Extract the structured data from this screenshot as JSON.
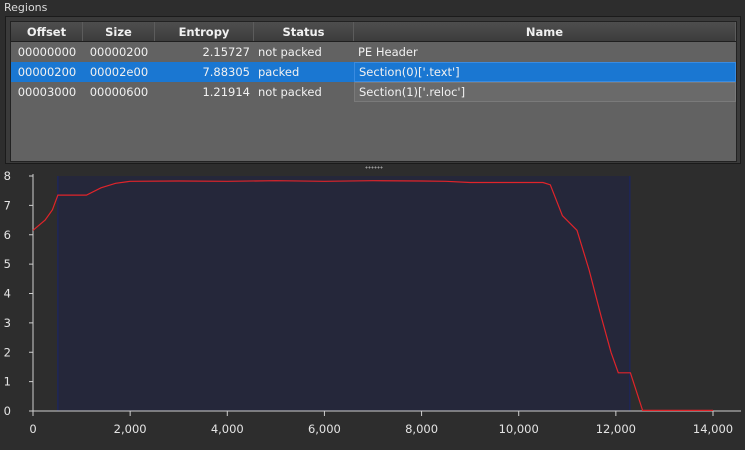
{
  "group": {
    "title": "Regions"
  },
  "table": {
    "headers": [
      "Offset",
      "Size",
      "Entropy",
      "Status",
      "Name"
    ],
    "rows": [
      {
        "offset": "00000000",
        "size": "00000200",
        "entropy": "2.15727",
        "status": "not packed",
        "name": "PE Header",
        "selected": false
      },
      {
        "offset": "00000200",
        "size": "00002e00",
        "entropy": "7.88305",
        "status": "packed",
        "name": "Section(0)['.text']",
        "selected": true
      },
      {
        "offset": "00003000",
        "size": "00000600",
        "entropy": "1.21914",
        "status": "not packed",
        "name": "Section(1)['.reloc']",
        "selected": false
      }
    ]
  },
  "chart_data": {
    "type": "line",
    "title": "",
    "xlabel": "",
    "ylabel": "",
    "xlim": [
      0,
      14000
    ],
    "ylim": [
      0,
      8
    ],
    "x_ticks": [
      0,
      2000,
      4000,
      6000,
      8000,
      10000,
      12000,
      14000
    ],
    "x_tick_labels": [
      "0",
      "2,000",
      "4,000",
      "6,000",
      "8,000",
      "10,000",
      "12,000",
      "14,000"
    ],
    "y_ticks": [
      0,
      1,
      2,
      3,
      4,
      5,
      6,
      7,
      8
    ],
    "y_tick_labels": [
      "0",
      "1",
      "2",
      "3",
      "4",
      "5",
      "6",
      "7",
      "8"
    ],
    "highlight_region": {
      "x_start": 512,
      "x_end": 12288,
      "color": "#25273a"
    },
    "series": [
      {
        "color": "#e0242a",
        "x": [
          0,
          250,
          400,
          512,
          700,
          1000,
          1100,
          1400,
          1700,
          2000,
          3000,
          4000,
          5000,
          6000,
          7000,
          8000,
          8500,
          9000,
          10000,
          10500,
          10650,
          10900,
          11200,
          11450,
          11700,
          11900,
          12050,
          12300,
          12550,
          13000,
          14000
        ],
        "y": [
          6.15,
          6.5,
          6.85,
          7.35,
          7.35,
          7.35,
          7.35,
          7.6,
          7.75,
          7.82,
          7.83,
          7.82,
          7.84,
          7.82,
          7.84,
          7.83,
          7.82,
          7.78,
          7.78,
          7.78,
          7.7,
          6.65,
          6.15,
          4.8,
          3.2,
          2.0,
          1.3,
          1.3,
          0.02,
          0.02,
          0.02
        ]
      }
    ]
  }
}
